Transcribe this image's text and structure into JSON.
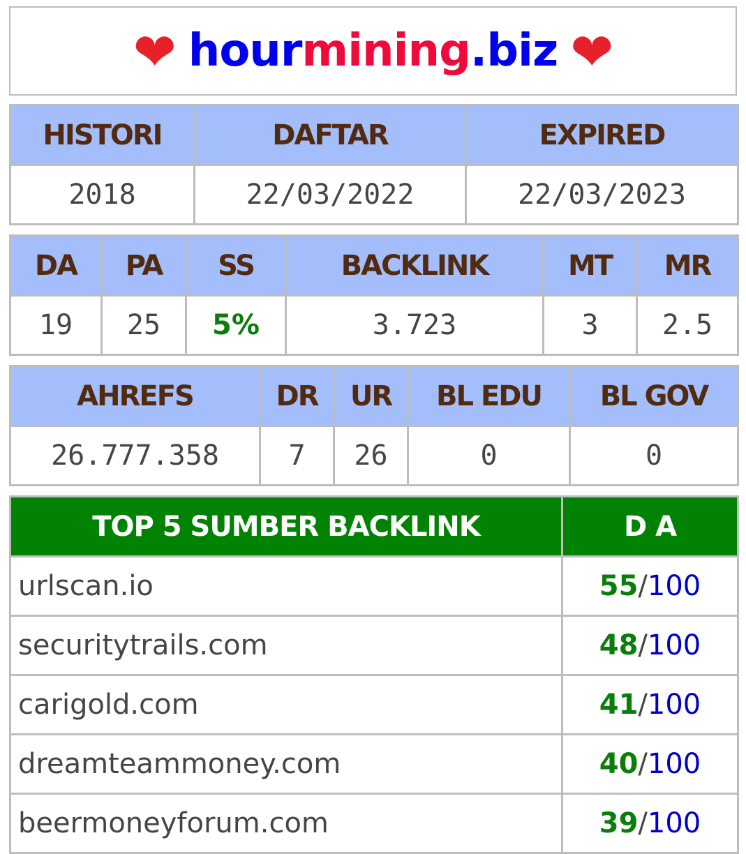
{
  "header": {
    "domain_part1": "hour",
    "domain_part2": "mining",
    "domain_part3": ".biz",
    "heart_icon": "❤"
  },
  "history": {
    "headers": [
      "HISTORI",
      "DAFTAR",
      "EXPIRED"
    ],
    "values": [
      "2018",
      "22/03/2022",
      "22/03/2023"
    ]
  },
  "moz": {
    "headers": [
      "DA",
      "PA",
      "SS",
      "BACKLINK",
      "MT",
      "MR"
    ],
    "values": [
      "19",
      "25",
      "5%",
      "3.723",
      "3",
      "2.5"
    ]
  },
  "ahrefs": {
    "headers": [
      "AHREFS",
      "DR",
      "UR",
      "BL EDU",
      "BL GOV"
    ],
    "values": [
      "26.777.358",
      "7",
      "26",
      "0",
      "0"
    ]
  },
  "top_backlinks": {
    "header_source": "TOP 5 SUMBER BACKLINK",
    "header_da": "D A",
    "separator": "/",
    "max": "100",
    "rows": [
      {
        "source": "urlscan.io",
        "da": "55"
      },
      {
        "source": "securitytrails.com",
        "da": "48"
      },
      {
        "source": "carigold.com",
        "da": "41"
      },
      {
        "source": "dreamteammoney.com",
        "da": "40"
      },
      {
        "source": "beermoneyforum.com",
        "da": "39"
      }
    ]
  },
  "colors": {
    "header_bg": "#a4befb",
    "header_text": "#512a10",
    "green_header_bg": "#028202",
    "green_value": "#0a7d0a",
    "blue": "#0000ee",
    "red": "#ee0a3a"
  }
}
